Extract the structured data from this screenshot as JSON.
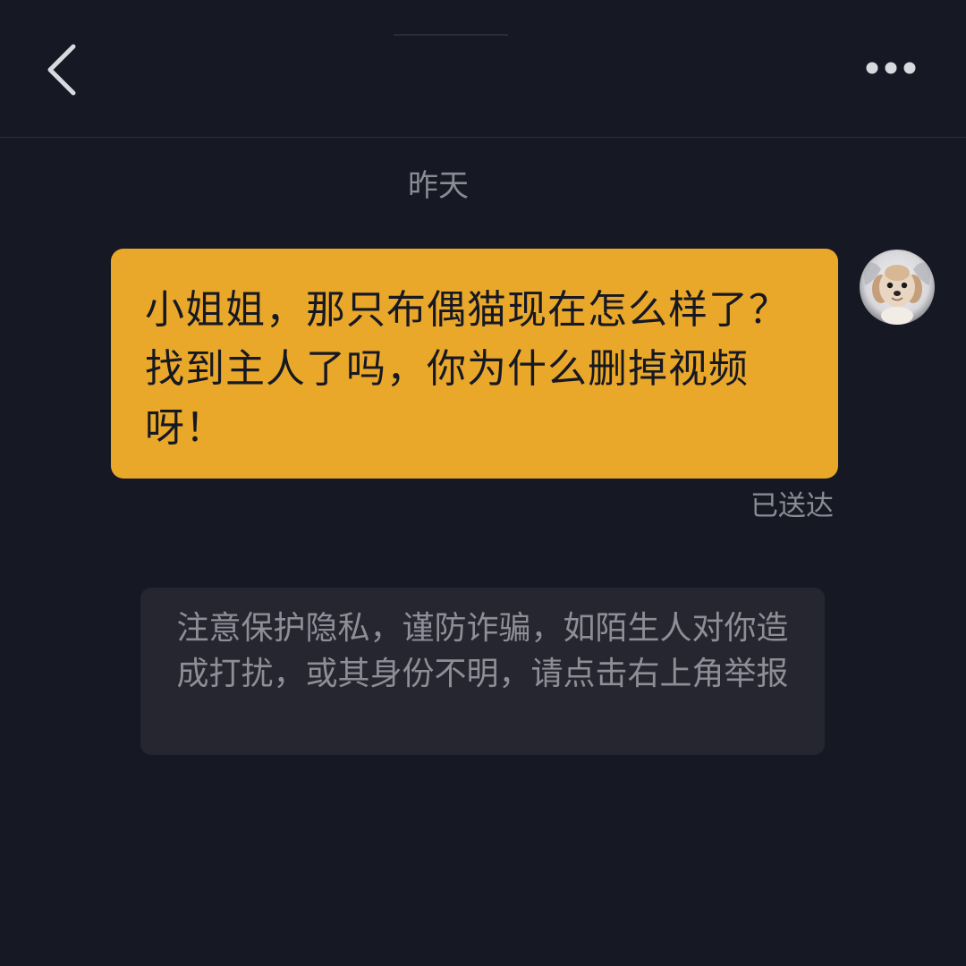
{
  "header": {
    "back_icon": "chevron-left-icon",
    "more_icon": "more-horizontal-icon"
  },
  "chat": {
    "date_separator": "昨天",
    "outgoing_message": {
      "text": "小姐姐，那只布偶猫现在怎么样了？找到主人了吗，你为什么删掉视频呀！",
      "status": "已送达",
      "bubble_color": "#eaa82a"
    },
    "avatar_icon": "dog-avatar"
  },
  "system_notice": {
    "text": "注意保护隐私，谨防诈骗，如陌生人对你造成打扰，或其身份不明，请点击右上角举报"
  },
  "colors": {
    "background": "#161823",
    "accent": "#eaa82a",
    "notice_background": "#252630",
    "muted_text": "#8a8b93"
  }
}
